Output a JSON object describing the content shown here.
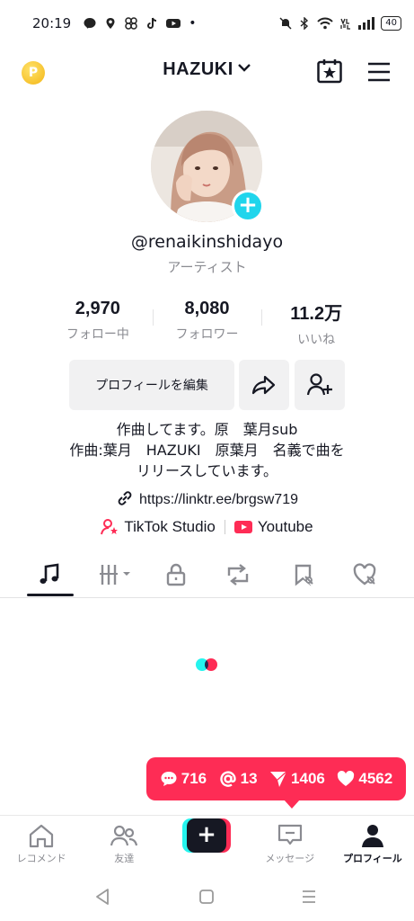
{
  "status_bar": {
    "time": "20:19",
    "dot": "•",
    "battery": "40"
  },
  "header": {
    "username": "HAZUKI"
  },
  "profile": {
    "handle": "@renaikinshidayo",
    "role": "アーティスト",
    "add_badge": "+"
  },
  "stats": [
    {
      "value": "2,970",
      "label": "フォロー中"
    },
    {
      "value": "8,080",
      "label": "フォロワー"
    },
    {
      "value": "11.2万",
      "label": "いいね"
    }
  ],
  "actions": {
    "edit_profile": "プロフィールを編集"
  },
  "bio": "作曲してます。原　葉月sub\n作曲:葉月　HAZUKI　原葉月　名義で曲を\nリリースしています。",
  "link": "https://linktr.ee/brgsw719",
  "apps": [
    {
      "label": "TikTok Studio"
    },
    {
      "label": "Youtube"
    }
  ],
  "notification": {
    "comments": "716",
    "mentions": "13",
    "followers": "1406",
    "likes": "4562"
  },
  "bottom_nav": {
    "home": "レコメンド",
    "friends": "友達",
    "create": "+",
    "inbox": "メッセージ",
    "profile": "プロフィール"
  },
  "colors": {
    "accent": "#fe2c55",
    "cyan": "#25f4ee",
    "badge": "#20d5ec"
  }
}
